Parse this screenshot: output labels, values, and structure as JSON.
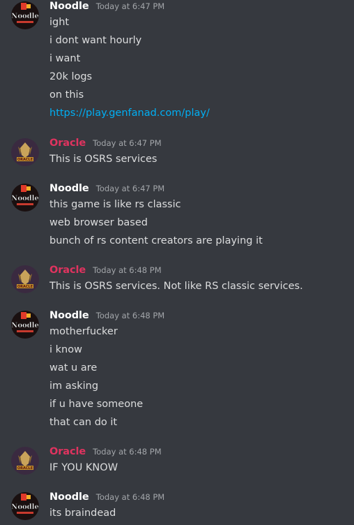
{
  "colors": {
    "background": "#36393f",
    "text": "#dcddde",
    "noodle_name": "#ffffff",
    "oracle_name": "#e0335f",
    "timestamp": "#a3a6aa",
    "link": "#00aff4"
  },
  "messages": [
    {
      "author": "Noodle",
      "time": "Today at 6:47 PM",
      "avatar": "noodle-avatar",
      "lines": [
        "ight",
        "i dont want hourly",
        "i want",
        "20k logs",
        "on this",
        "https://play.genfanad.com/play/"
      ]
    },
    {
      "author": "Oracle",
      "time": "Today at 6:47 PM",
      "avatar": "oracle-avatar",
      "lines": [
        "This is OSRS services"
      ]
    },
    {
      "author": "Noodle",
      "time": "Today at 6:47 PM",
      "avatar": "noodle-avatar",
      "lines": [
        "this game is like rs classic",
        "web browser based",
        "bunch of rs content creators are playing it"
      ]
    },
    {
      "author": "Oracle",
      "time": "Today at 6:48 PM",
      "avatar": "oracle-avatar",
      "lines": [
        "This is OSRS services. Not like RS classic services."
      ]
    },
    {
      "author": "Noodle",
      "time": "Today at 6:48 PM",
      "avatar": "noodle-avatar",
      "lines": [
        "motherfucker",
        "i know",
        "wat u are",
        "im asking",
        "if u have someone",
        "that can do it"
      ]
    },
    {
      "author": "Oracle",
      "time": "Today at 6:48 PM",
      "avatar": "oracle-avatar",
      "lines": [
        "IF YOU KNOW"
      ]
    },
    {
      "author": "Noodle",
      "time": "Today at 6:48 PM",
      "avatar": "noodle-avatar",
      "lines": [
        "its braindead"
      ]
    }
  ],
  "avatar_text": {
    "noodle": "Noodle",
    "oracle": "ORACLE"
  }
}
